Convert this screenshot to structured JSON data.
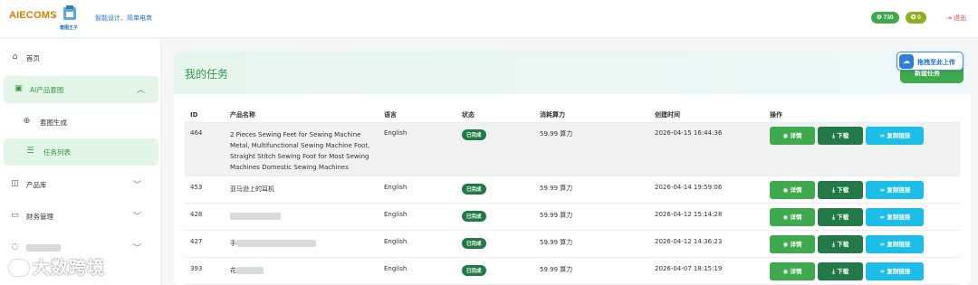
{
  "header": {
    "logo_text": "AIECOMS",
    "logo_x": "×",
    "partner_name": "套图王子",
    "tagline": "智能设计、简单电商",
    "points_value": "730",
    "vip_value": "0",
    "logout_label": "退出",
    "points_icon": "gear-coin-icon",
    "vip_icon": "star-icon"
  },
  "sidebar": {
    "items": [
      {
        "label": "首页",
        "icon": "home-icon"
      },
      {
        "label": "AI产品套图",
        "icon": "image-icon"
      },
      {
        "label": "套图生成",
        "icon": "plus-circle-icon"
      },
      {
        "label": "任务列表",
        "icon": "list-icon"
      },
      {
        "label": "产品库",
        "icon": "box-icon"
      },
      {
        "label": "财务管理",
        "icon": "wallet-icon"
      }
    ],
    "watermark": "大数跨境"
  },
  "main": {
    "title": "我的任务",
    "new_task_label": "新建任务",
    "float_upload_label": "拖拽至此上传",
    "columns": [
      "ID",
      "产品名称",
      "语言",
      "状态",
      "消耗算力",
      "创建时间",
      "操作"
    ],
    "actions": {
      "detail": "详情",
      "download": "下载",
      "copy": "复制链接"
    },
    "rows": [
      {
        "id": "464",
        "name": "2 Pieces Sewing Feet for Sewing Machine Metal, Multifunctional Sewing Machine Foot, Straight Stitch Sewing Foot for Most Sewing Machines Domestic Sewing Machines",
        "lang": "English",
        "status": "已完成",
        "cost": "59.99 算力",
        "time": "2026-04-15 16:44:36"
      },
      {
        "id": "453",
        "name": "亚马逊上的耳机",
        "lang": "English",
        "status": "已完成",
        "cost": "59.99 算力",
        "time": "2026-04-14 19:59:06"
      },
      {
        "id": "428",
        "name": "",
        "lang": "English",
        "status": "已完成",
        "cost": "59.99 算力",
        "time": "2026-04-12 15:14:28"
      },
      {
        "id": "427",
        "name": "手",
        "lang": "English",
        "status": "已完成",
        "cost": "59.99 算力",
        "time": "2026-04-12 14:36:23"
      },
      {
        "id": "393",
        "name": "花",
        "lang": "English",
        "status": "已完成",
        "cost": "59.99 算力",
        "time": "2026-04-07 18:15:19"
      }
    ]
  },
  "colors": {
    "accent": "#3fa94d",
    "dark_green": "#237a48",
    "cyan": "#1cbde8"
  }
}
